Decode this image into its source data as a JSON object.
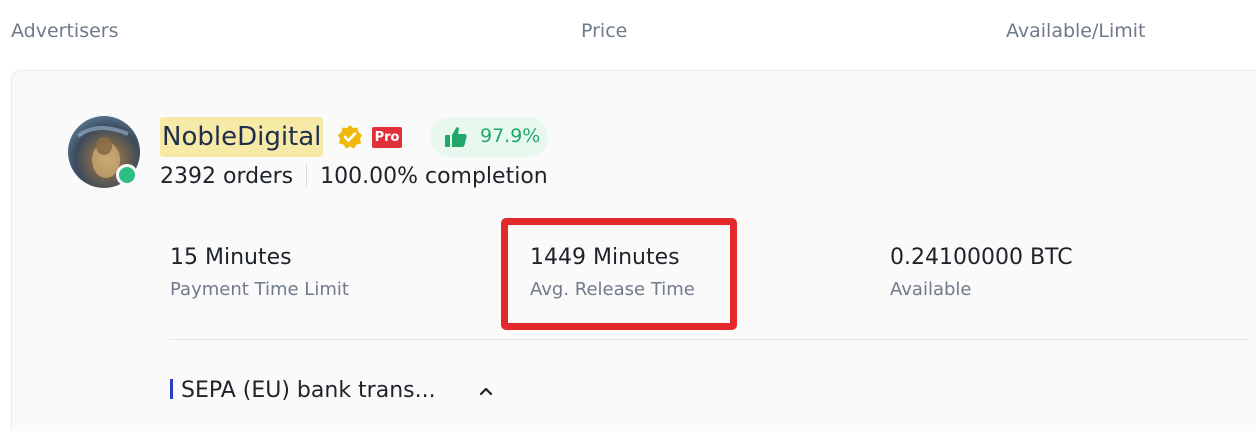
{
  "header": {
    "col_advertisers": "Advertisers",
    "col_price": "Price",
    "col_available": "Available/Limit"
  },
  "advertiser": {
    "name": "NobleDigital",
    "pro_badge": "Pro",
    "positive_rate": "97.9%",
    "orders": "2392 orders",
    "completion": "100.00% completion",
    "online": true,
    "icons": [
      "verified-icon",
      "thumbs-up-icon",
      "online-status-icon"
    ]
  },
  "stats": {
    "payment_time_value": "15 Minutes",
    "payment_time_label": "Payment Time Limit",
    "release_time_value": "1449 Minutes",
    "release_time_label": "Avg. Release Time",
    "available_value": "0.24100000 BTC",
    "available_label": "Available"
  },
  "payment": {
    "method": "SEPA (EU) bank trans...",
    "expanded_icon": "chevron-up-icon"
  },
  "colors": {
    "highlight": "#e3292b",
    "positive": "#20a86a",
    "pro": "#e0303a",
    "verify": "#f0b90b",
    "online": "#2ebd85",
    "sepa_bar": "#2a3fbf"
  }
}
